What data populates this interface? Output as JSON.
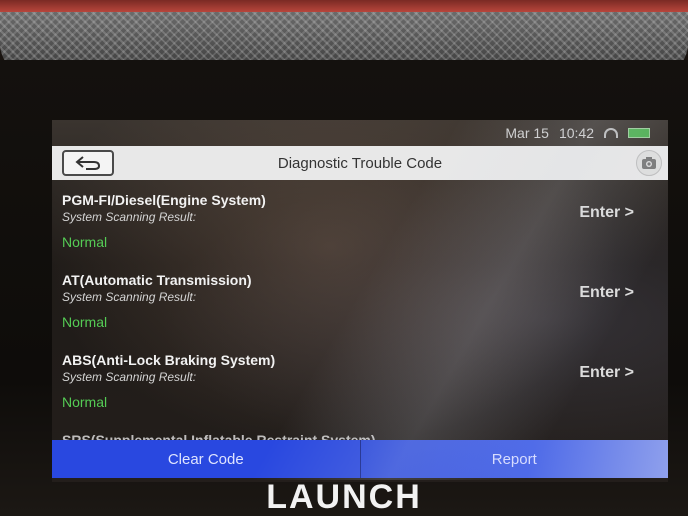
{
  "device": {
    "brand": "LAUNCH"
  },
  "status_bar": {
    "date": "Mar 15",
    "time": "10:42"
  },
  "header": {
    "title": "Diagnostic Trouble Code"
  },
  "icons": {
    "back": "back-arrow-icon",
    "camera": "camera-icon",
    "wifi": "wifi-icon",
    "battery": "battery-icon"
  },
  "systems": [
    {
      "name": "PGM-FI/Diesel(Engine System)",
      "subtitle": "System Scanning Result:",
      "status": "Normal",
      "action": "Enter >"
    },
    {
      "name": "AT(Automatic Transmission)",
      "subtitle": "System Scanning Result:",
      "status": "Normal",
      "action": "Enter >"
    },
    {
      "name": "ABS(Anti-Lock Braking System)",
      "subtitle": "System Scanning Result:",
      "status": "Normal",
      "action": "Enter >"
    },
    {
      "name": "SRS(Supplemental Inflatable Restraint System)"
    }
  ],
  "footer": {
    "clear_label": "Clear Code",
    "report_label": "Report"
  },
  "colors": {
    "status_normal": "#55cc55",
    "button_blue": "#2948e0",
    "title_bar": "#e8e8e8"
  }
}
